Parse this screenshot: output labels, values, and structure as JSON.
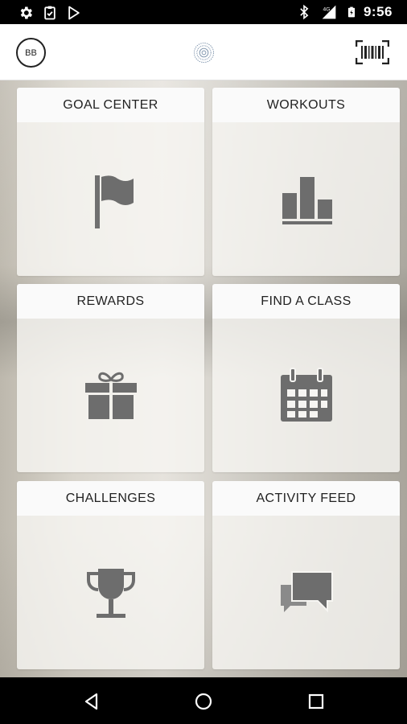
{
  "status_bar": {
    "time": "9:56",
    "left_icons": [
      "settings-icon",
      "clipboard-check-icon",
      "play-store-icon"
    ],
    "right_icons": [
      "bluetooth-icon",
      "signal-4g-icon",
      "battery-icon"
    ],
    "network": "4G"
  },
  "app_bar": {
    "avatar_initials": "BB",
    "logo_icon": "mandala-logo-icon",
    "barcode_icon": "barcode-scan-icon"
  },
  "tiles": [
    {
      "label": "GOAL CENTER",
      "icon": "flag-icon"
    },
    {
      "label": "WORKOUTS",
      "icon": "bar-chart-icon"
    },
    {
      "label": "REWARDS",
      "icon": "gift-icon"
    },
    {
      "label": "FIND A CLASS",
      "icon": "calendar-icon"
    },
    {
      "label": "CHALLENGES",
      "icon": "trophy-icon"
    },
    {
      "label": "ACTIVITY FEED",
      "icon": "chat-bubbles-icon"
    }
  ],
  "colors": {
    "icon_gray": "#6d6d6d",
    "header_bg": "#fafafa",
    "app_bar_bg": "#ffffff"
  },
  "nav_bar": {
    "buttons": [
      "back-icon",
      "home-icon",
      "recents-icon"
    ]
  }
}
